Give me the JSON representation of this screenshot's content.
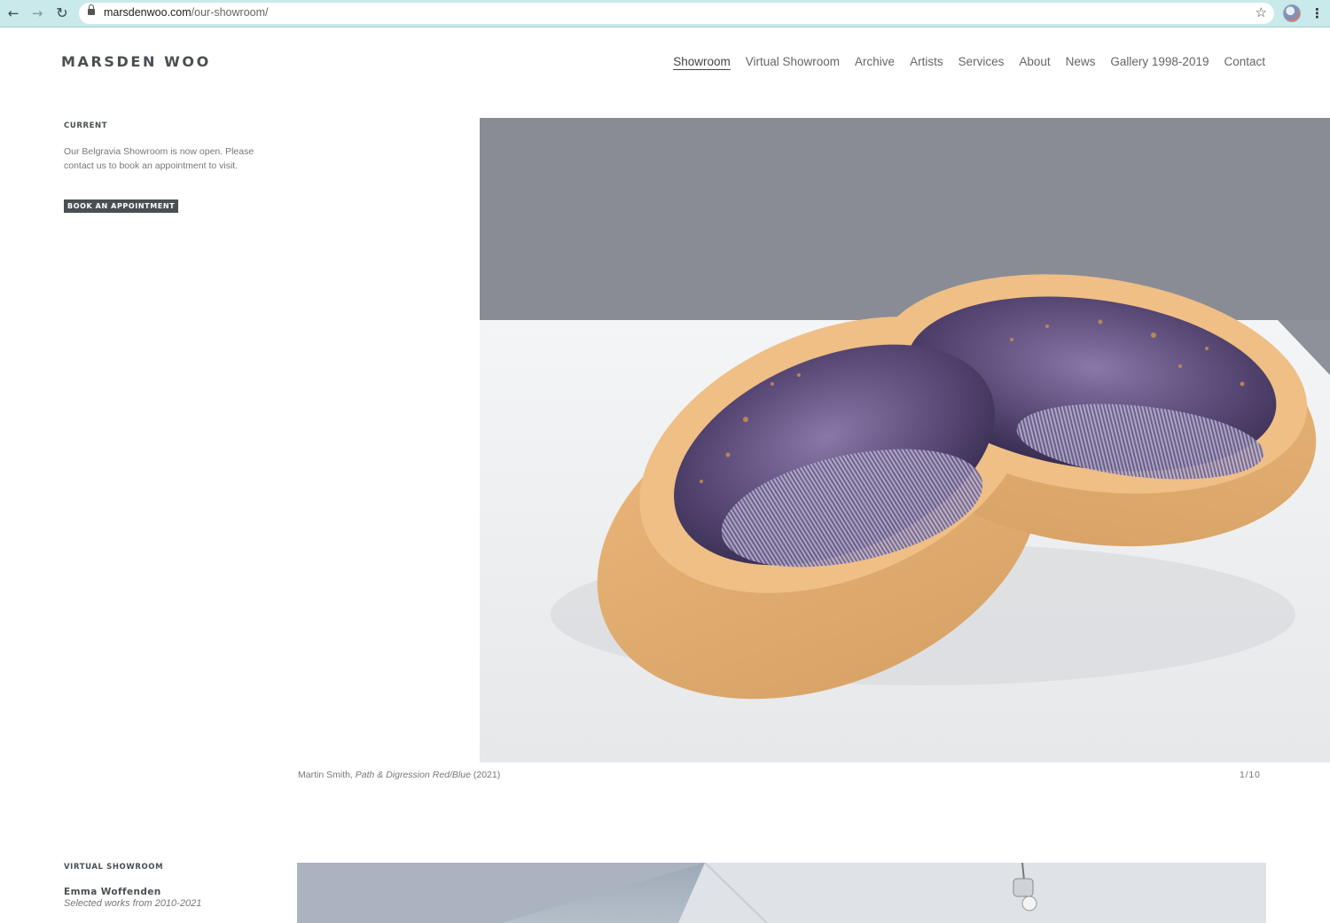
{
  "browser": {
    "url_domain": "marsdenwoo.com",
    "url_path": "/our-showroom/",
    "icons": [
      "back-arrow-icon",
      "forward-arrow-icon",
      "reload-icon",
      "lock-icon",
      "bookmark-star-icon",
      "profile-avatar",
      "more-menu-icon"
    ]
  },
  "site": {
    "logo": "MARSDEN WOO",
    "nav": [
      "Showroom",
      "Virtual Showroom",
      "Archive",
      "Artists",
      "Services",
      "About",
      "News",
      "Gallery 1998-2019",
      "Contact"
    ],
    "active_nav": "Showroom"
  },
  "current": {
    "label": "CURRENT",
    "text": "Our Belgravia Showroom is now open. Please contact us to book an appointment to visit.",
    "button": "BOOK AN APPOINTMENT"
  },
  "hero": {
    "caption_artist": "Martin Smith,",
    "caption_title": "Path & Digression Red/Blue",
    "caption_year": "(2021)",
    "counter": "1/10"
  },
  "virtual_showroom": {
    "label": "VIRTUAL SHOWROOM",
    "artist": "Emma Woffenden",
    "subtitle": "Selected works from 2010-2021"
  }
}
